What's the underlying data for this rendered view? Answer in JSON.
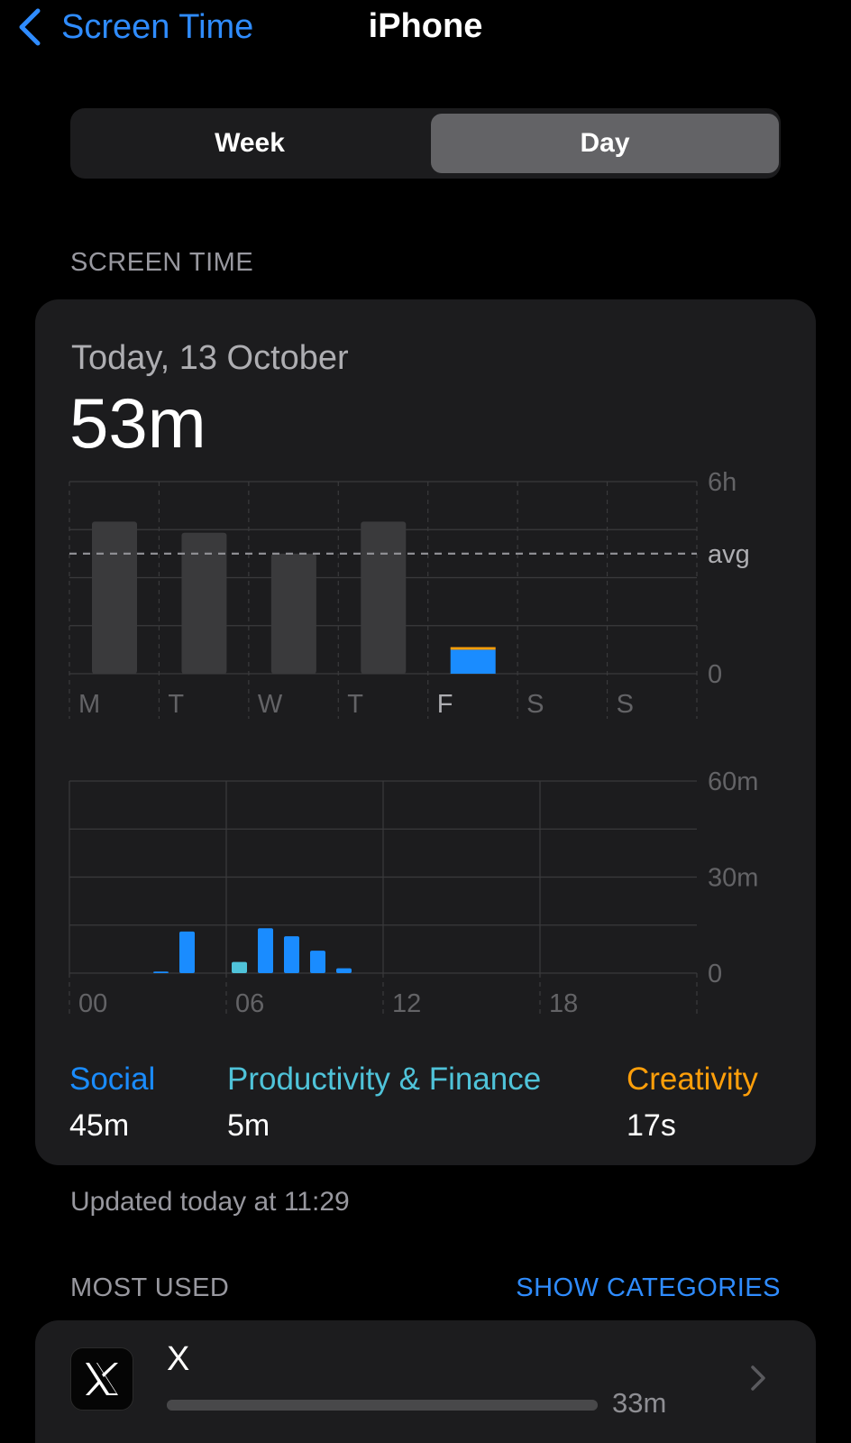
{
  "nav": {
    "back_label": "Screen Time",
    "title": "iPhone"
  },
  "segmented": {
    "week_label": "Week",
    "day_label": "Day",
    "selected": "Day"
  },
  "screen_time_section": {
    "label": "SCREEN TIME"
  },
  "summary": {
    "date": "Today, 13 October",
    "total": "53m"
  },
  "colors": {
    "social": "#1a8cff",
    "productivity": "#4fc3d9",
    "creativity": "#ff9f0a",
    "history_bar": "#3a3a3c",
    "accent": "#2f8cff"
  },
  "chart_data": [
    {
      "type": "bar",
      "categories": [
        "M",
        "T",
        "W",
        "T",
        "F",
        "S",
        "S"
      ],
      "series": [
        {
          "values": [
            4.75,
            4.4,
            3.75,
            4.75,
            null,
            null,
            null
          ]
        },
        {
          "values": [
            null,
            null,
            null,
            null,
            0.75,
            null,
            null
          ]
        },
        {
          "values": [
            null,
            null,
            null,
            null,
            0.08,
            null,
            null
          ]
        }
      ],
      "y_ticks": [
        "6h",
        "avg",
        "0"
      ],
      "avg": 3.75,
      "ylim": [
        0,
        6
      ],
      "highlighted": "F"
    },
    {
      "type": "bar",
      "x": [
        3,
        4,
        5,
        6,
        7,
        8,
        9,
        10
      ],
      "series": [
        {
          "values": [
            0.5,
            13,
            0,
            0,
            14,
            11.5,
            7,
            1.5
          ]
        },
        {
          "values": [
            0,
            0,
            0,
            3.5,
            0,
            0,
            0,
            0
          ]
        }
      ],
      "x_ticks": [
        "00",
        "06",
        "12",
        "18"
      ],
      "y_ticks": [
        "60m",
        "30m",
        "0"
      ],
      "ylim": [
        0,
        60
      ]
    }
  ],
  "legend": [
    {
      "name": "Social",
      "value": "45m"
    },
    {
      "name": "Productivity & Finance",
      "value": "5m"
    },
    {
      "name": "Creativity",
      "value": "17s"
    }
  ],
  "updated": "Updated today at 11:29",
  "most_used": {
    "label": "MOST USED",
    "toggle_label": "SHOW CATEGORIES"
  },
  "apps": [
    {
      "name": "X",
      "time": "33m",
      "fraction": 1.0
    }
  ]
}
